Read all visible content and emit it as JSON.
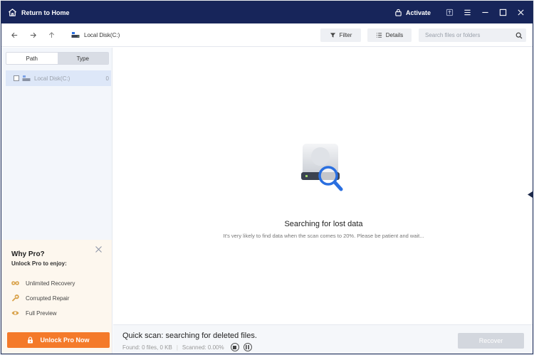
{
  "titlebar": {
    "home_label": "Return to Home",
    "activate_label": "Activate"
  },
  "toolbar": {
    "breadcrumb": "Local Disk(C:)",
    "filter_label": "Filter",
    "details_label": "Details",
    "search_placeholder": "Search files or folders"
  },
  "sidebar": {
    "tabs": [
      {
        "label": "Path",
        "active": true
      },
      {
        "label": "Type",
        "active": false
      }
    ],
    "tree": [
      {
        "label": "Local Disk(C:)",
        "count": "0"
      }
    ]
  },
  "promo": {
    "title": "Why Pro?",
    "subtitle": "Unlock Pro to enjoy:",
    "features": [
      {
        "label": "Unlimited Recovery",
        "icon": "infinity-icon"
      },
      {
        "label": "Corrupted Repair",
        "icon": "wrench-icon"
      },
      {
        "label": "Full Preview",
        "icon": "eye-icon"
      }
    ],
    "unlock_label": "Unlock Pro Now"
  },
  "main": {
    "status_title": "Searching for lost data",
    "status_subtitle": "It's very likely to find data when the scan comes to 20%. Please be patient and wait..."
  },
  "bottombar": {
    "scan_title": "Quick scan: searching for deleted files.",
    "found": "Found: 0 files, 0 KB",
    "scanned": "Scanned: 0.00%",
    "recover_label": "Recover"
  },
  "colors": {
    "titlebar": "#17255a",
    "accent": "#f47a2a",
    "selection": "#dde7f8",
    "search_blue": "#2a6fe0"
  }
}
